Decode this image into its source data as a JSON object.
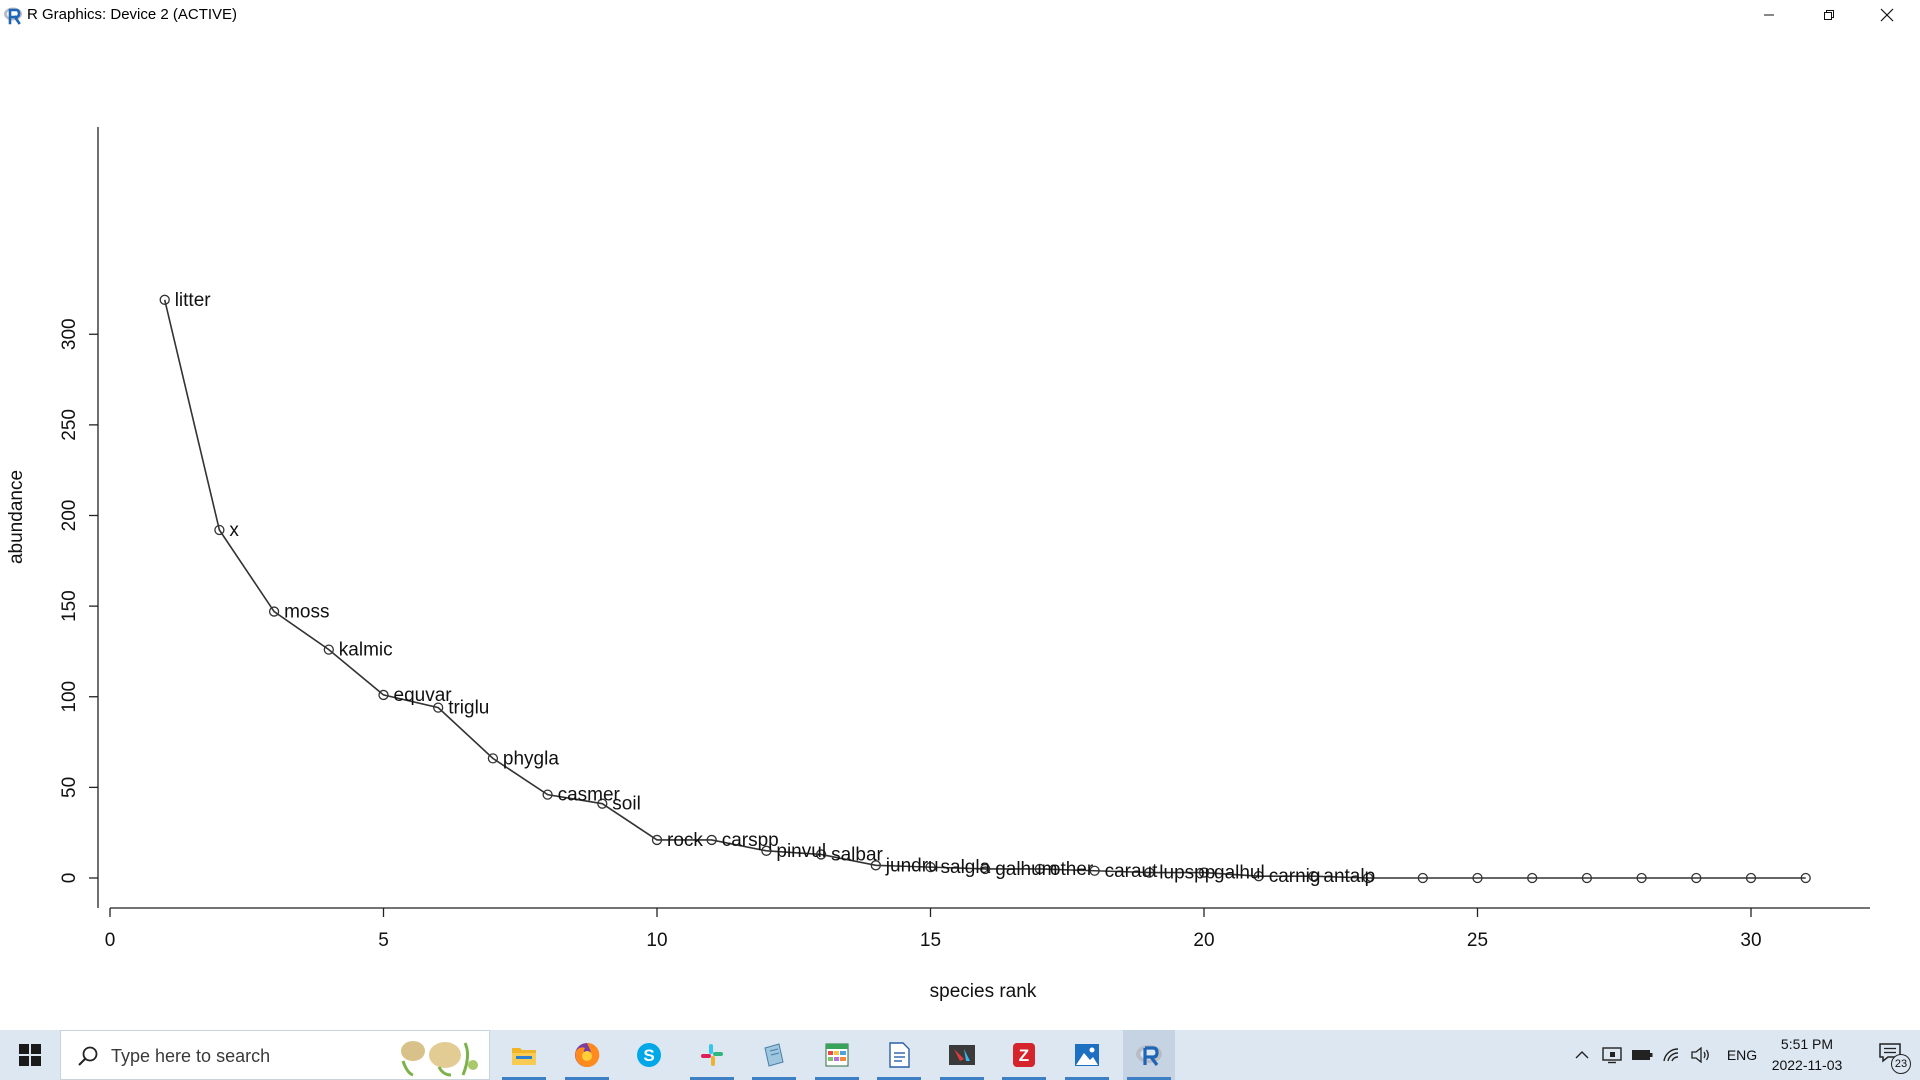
{
  "window": {
    "title": "R Graphics: Device 2 (ACTIVE)",
    "controls": [
      "minimize",
      "restore",
      "close"
    ]
  },
  "chart_data": {
    "type": "line",
    "title": "",
    "xlabel": "species rank",
    "ylabel": "abundance",
    "xlim": [
      0,
      31
    ],
    "ylim": [
      0,
      320
    ],
    "x_ticks": [
      0,
      5,
      10,
      15,
      20,
      25,
      30
    ],
    "y_ticks": [
      0,
      50,
      100,
      150,
      200,
      250,
      300
    ],
    "marker": "open-circle",
    "grid": false,
    "points": [
      {
        "x": 1,
        "y": 319,
        "label": "litter"
      },
      {
        "x": 2,
        "y": 192,
        "label": "x"
      },
      {
        "x": 3,
        "y": 147,
        "label": "moss"
      },
      {
        "x": 4,
        "y": 126,
        "label": "kalmic"
      },
      {
        "x": 5,
        "y": 101,
        "label": "equvar"
      },
      {
        "x": 6,
        "y": 94,
        "label": "triglu"
      },
      {
        "x": 7,
        "y": 66,
        "label": "phygla"
      },
      {
        "x": 8,
        "y": 46,
        "label": "casmer"
      },
      {
        "x": 9,
        "y": 41,
        "label": "soil"
      },
      {
        "x": 10,
        "y": 21,
        "label": "rock"
      },
      {
        "x": 11,
        "y": 21,
        "label": "carspp"
      },
      {
        "x": 12,
        "y": 15,
        "label": "pinvul"
      },
      {
        "x": 13,
        "y": 13,
        "label": "salbar"
      },
      {
        "x": 14,
        "y": 7,
        "label": "jundru"
      },
      {
        "x": 15,
        "y": 6,
        "label": "salgla"
      },
      {
        "x": 16,
        "y": 5,
        "label": "galhum"
      },
      {
        "x": 17,
        "y": 5,
        "label": "other"
      },
      {
        "x": 18,
        "y": 4,
        "label": "caraut"
      },
      {
        "x": 19,
        "y": 3,
        "label": "lupspp"
      },
      {
        "x": 20,
        "y": 3,
        "label": "galhul"
      },
      {
        "x": 21,
        "y": 1,
        "label": "carnig"
      },
      {
        "x": 22,
        "y": 1,
        "label": "antalp"
      },
      {
        "x": 23,
        "y": 0,
        "label": ""
      },
      {
        "x": 24,
        "y": 0,
        "label": ""
      },
      {
        "x": 25,
        "y": 0,
        "label": ""
      },
      {
        "x": 26,
        "y": 0,
        "label": ""
      },
      {
        "x": 27,
        "y": 0,
        "label": ""
      },
      {
        "x": 28,
        "y": 0,
        "label": ""
      },
      {
        "x": 29,
        "y": 0,
        "label": ""
      },
      {
        "x": 30,
        "y": 0,
        "label": ""
      },
      {
        "x": 31,
        "y": 0,
        "label": ""
      }
    ]
  },
  "taskbar": {
    "search_placeholder": "Type here to search",
    "apps": [
      {
        "name": "file-explorer-icon",
        "running": true,
        "active": false
      },
      {
        "name": "firefox-icon",
        "running": true,
        "active": false
      },
      {
        "name": "skype-icon",
        "running": false,
        "active": false
      },
      {
        "name": "slack-icon",
        "running": true,
        "active": false
      },
      {
        "name": "notepad-icon",
        "running": true,
        "active": false
      },
      {
        "name": "spreadsheet-icon",
        "running": true,
        "active": false
      },
      {
        "name": "document-icon",
        "running": true,
        "active": false
      },
      {
        "name": "snipping-tool-icon",
        "running": true,
        "active": false
      },
      {
        "name": "zotero-icon",
        "running": true,
        "active": false
      },
      {
        "name": "photos-icon",
        "running": true,
        "active": false
      },
      {
        "name": "r-icon",
        "running": true,
        "active": true
      }
    ],
    "tray": {
      "language": "ENG",
      "time": "5:51 PM",
      "date": "2022-11-03",
      "notification_count": "23"
    },
    "colors": {
      "taskbar_bg": "#dde7f1",
      "running_underline": "#3c7fc4"
    }
  }
}
